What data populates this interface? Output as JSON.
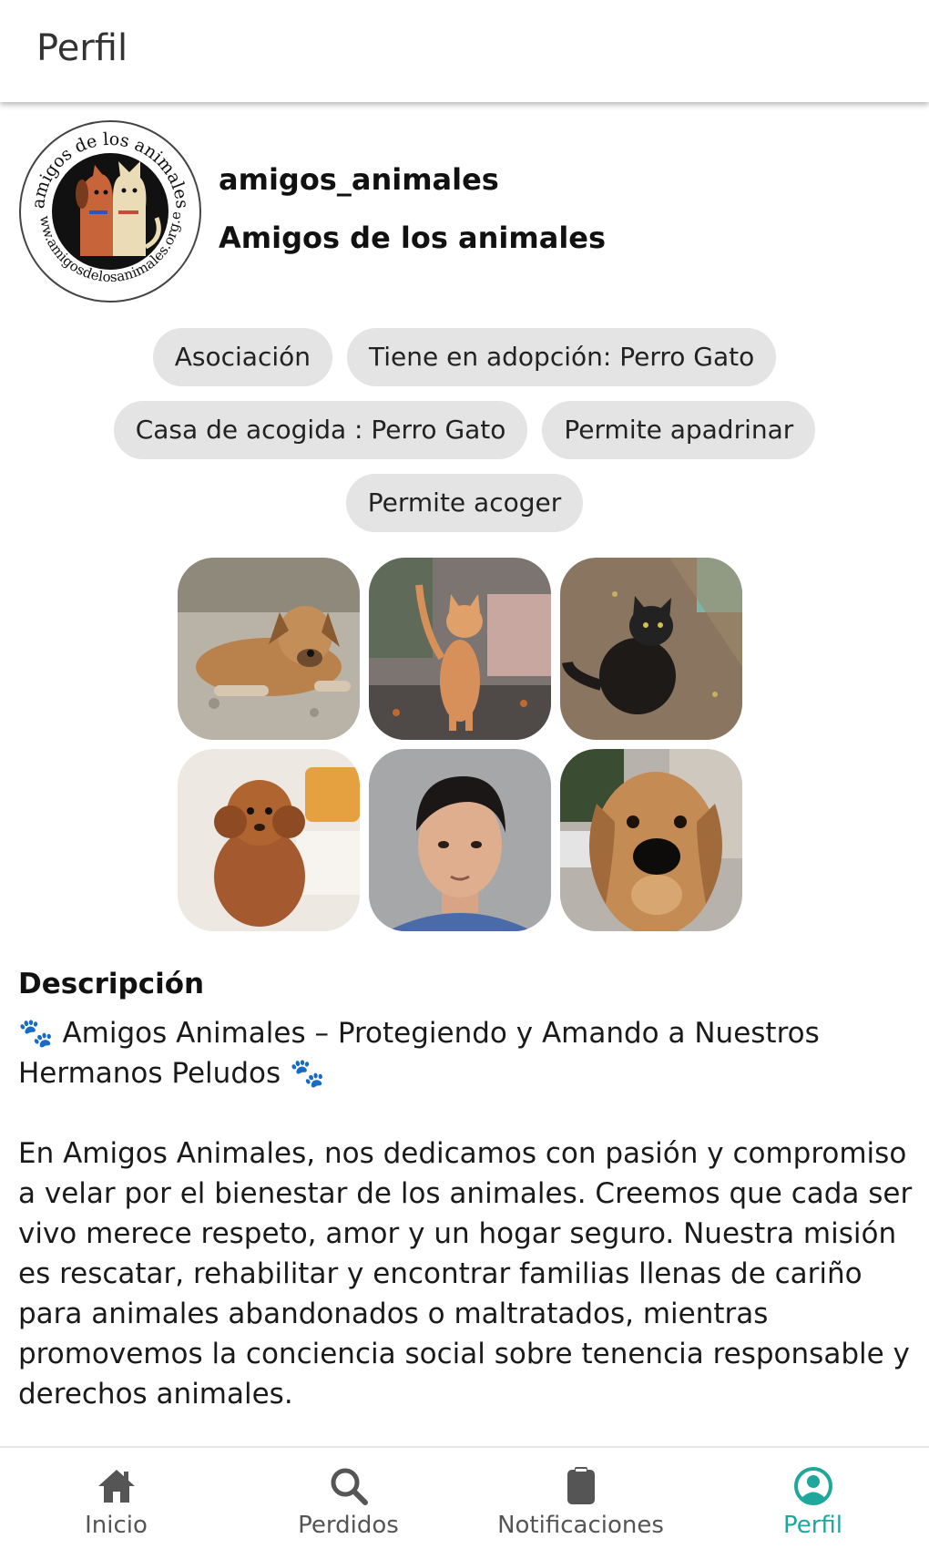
{
  "topbar": {
    "title": "Perfil"
  },
  "profile": {
    "username": "amigos_animales",
    "display_name": "Amigos de los animales",
    "avatar_logo_text": "amigos de los animales · www.amigosdelosanimales.org.es"
  },
  "chips": [
    "Asociación",
    "Tiene en adopción: Perro Gato",
    "Casa de acogida : Perro Gato",
    "Permite apadrinar",
    "Permite acoger"
  ],
  "gallery": [
    {
      "name": "photo-puppy-lying"
    },
    {
      "name": "photo-orange-cat"
    },
    {
      "name": "photo-black-cat"
    },
    {
      "name": "photo-poodle"
    },
    {
      "name": "photo-man-portrait"
    },
    {
      "name": "photo-dog-face"
    }
  ],
  "description": {
    "title": "Descripción",
    "paw_emoji": "🐾",
    "headline": "Amigos Animales – Protegiendo y Amando a Nuestros Hermanos Peludos",
    "body": "En Amigos Animales, nos dedicamos con pasión y compromiso a velar por el bienestar de los animales. Creemos que cada ser vivo merece respeto, amor y un hogar seguro. Nuestra misión es rescatar, rehabilitar y encontrar familias llenas de cariño para animales abandonados o maltratados, mientras promovemos la conciencia social sobre tenencia responsable y derechos animales."
  },
  "bottom_nav": {
    "items": [
      {
        "label": "Inicio",
        "icon": "home-icon"
      },
      {
        "label": "Perdidos",
        "icon": "search-icon"
      },
      {
        "label": "Notificaciones",
        "icon": "clipboard-icon"
      },
      {
        "label": "Perfil",
        "icon": "profile-icon"
      }
    ],
    "active_index": 3
  },
  "colors": {
    "accent": "#1fa79b",
    "chip_bg": "#e4e4e4",
    "nav_inactive": "#555555"
  }
}
